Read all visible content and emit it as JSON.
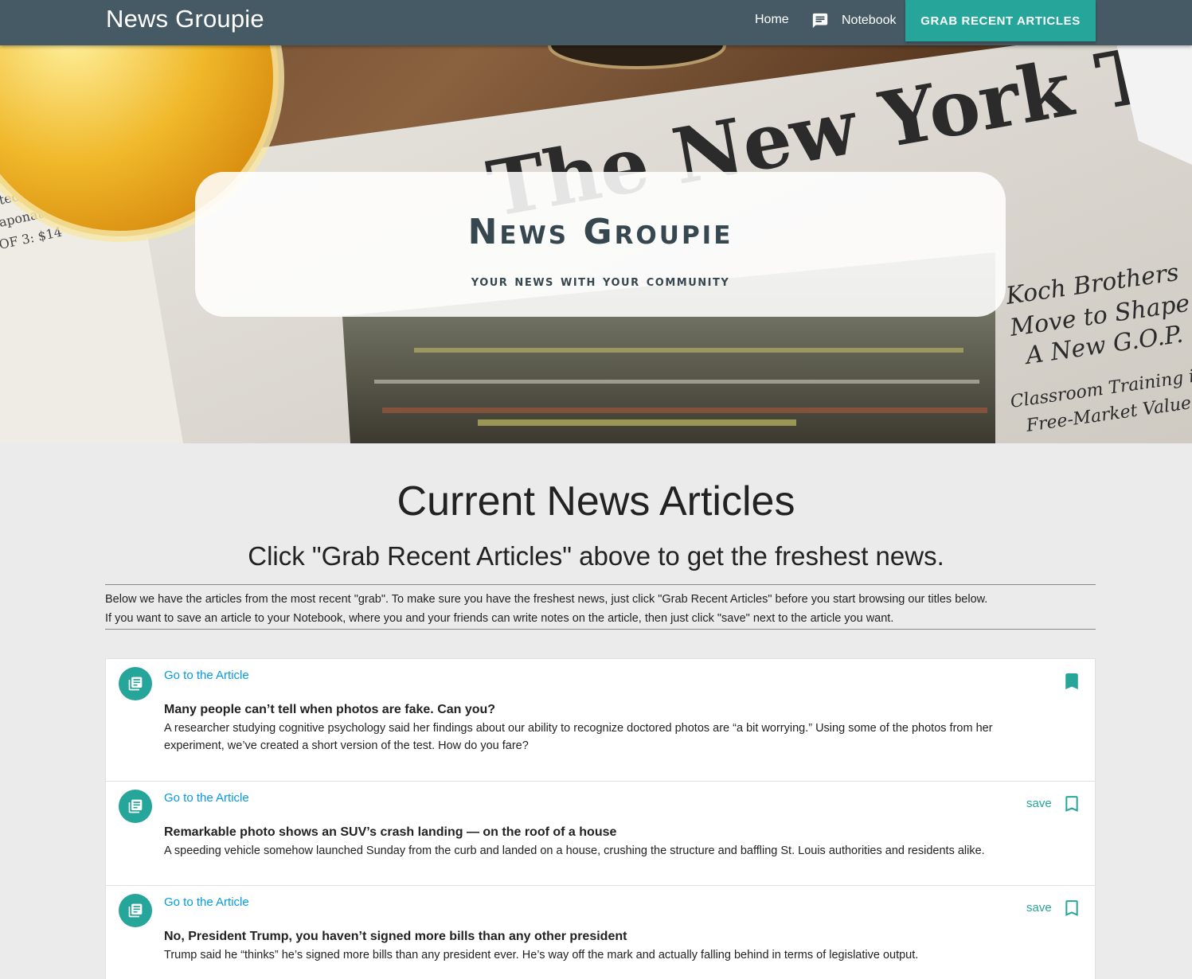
{
  "nav": {
    "brand": "News Groupie",
    "home": "Home",
    "notebook": "Notebook",
    "grab_button": "Grab Recent Articles",
    "notebook_icon": "comment-icon"
  },
  "hero": {
    "title": "News Groupie",
    "subtitle": "your news with your community"
  },
  "main": {
    "title": "Current News Articles",
    "subtitle": "Click \"Grab Recent Articles\" above to get the freshest news.",
    "info_line1": "Below we have the articles from the most recent \"grab\". To make sure you have the freshest news, just click \"Grab Recent Articles\" before you start browsing our titles below.",
    "info_line2": "If you want to save an article to your Notebook, where you and your friends can write notes on the article, then just click \"save\" next to the article you want."
  },
  "articles": [
    {
      "link": "Go to the Article",
      "headline": "Many people can’t tell when photos are fake. Can you?",
      "summary": "A researcher studying cognitive psychology said her findings about our ability to recognize doctored photos are “a bit worrying.” Using some of the photos from her experiment, we’ve created a short version of the test. How do you fare?",
      "saved": true,
      "save_label": ""
    },
    {
      "link": "Go to the Article",
      "headline": "Remarkable photo shows an SUV’s crash landing — on the roof of a house",
      "summary": "A speeding vehicle somehow launched Sunday from the curb and landed on a house, crushing the structure and baffling St. Louis authorities and residents alike.",
      "saved": false,
      "save_label": "save"
    },
    {
      "link": "Go to the Article",
      "headline": "No, President Trump, you haven’t signed more bills than any other president",
      "summary": "Trump said he “thinks” he’s signed more bills than any president ever. He’s way off the mark and actually falling behind in terms of legislative output.",
      "saved": false,
      "save_label": "save"
    }
  ],
  "colors": {
    "nav": "#455a64",
    "accent": "#26a69a",
    "link": "#039be5"
  }
}
